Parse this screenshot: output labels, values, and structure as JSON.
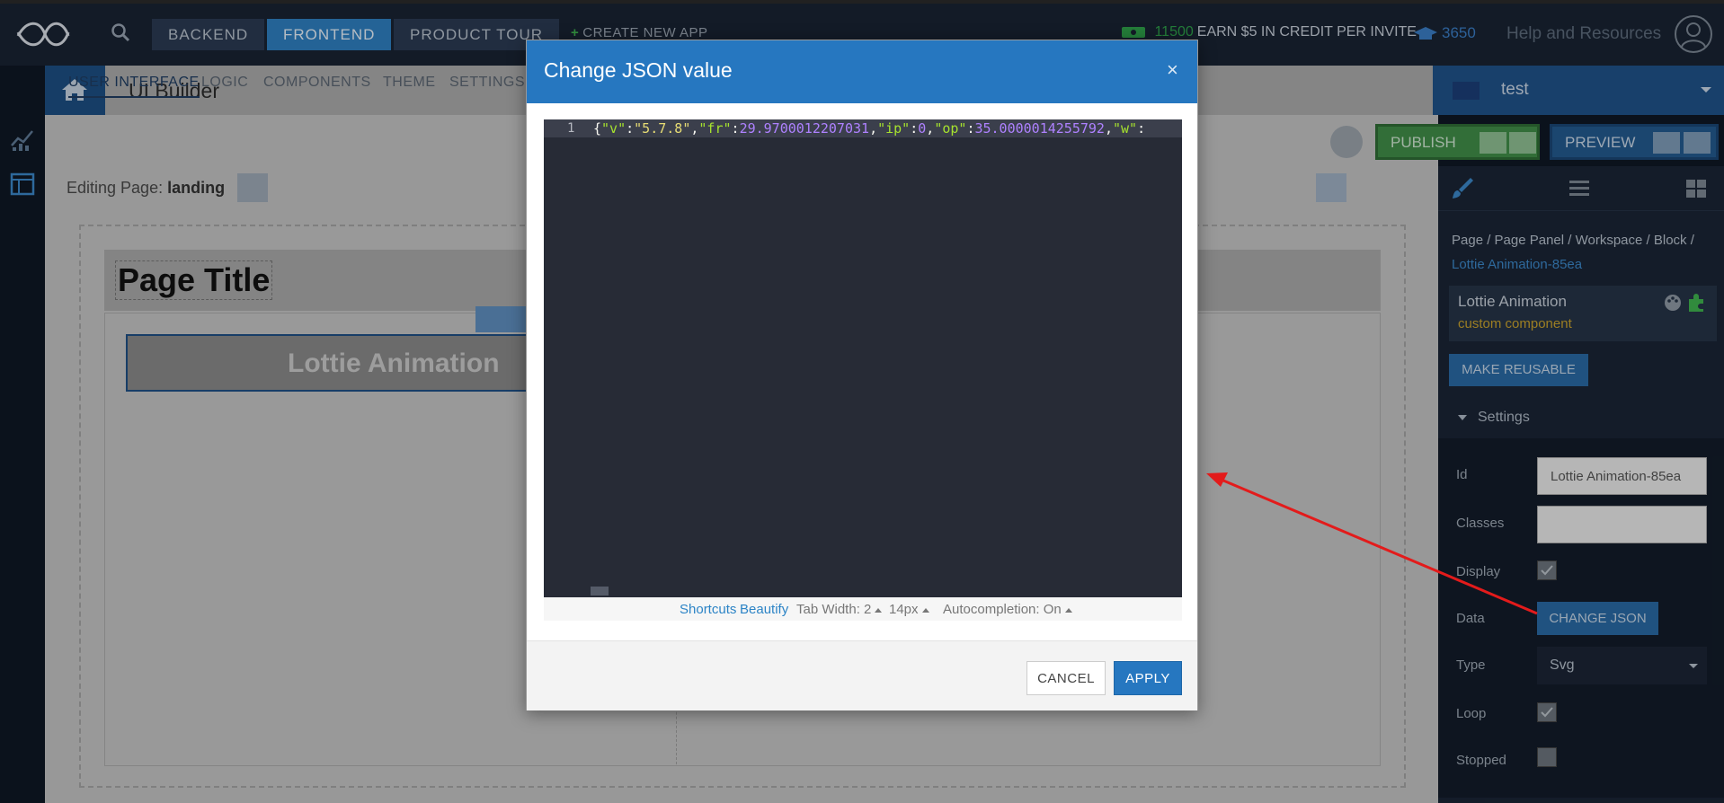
{
  "topbar": {
    "nav": [
      {
        "label": "BACKEND"
      },
      {
        "label": "FRONTEND"
      },
      {
        "label": "PRODUCT TOUR"
      }
    ],
    "create_app": "CREATE NEW APP",
    "credit_count": "11500",
    "credit_text": "EARN $5 IN CREDIT PER INVITE",
    "edu_count": "3650",
    "help": "Help and Resources"
  },
  "builder": {
    "title": "UI Builder",
    "project": "test",
    "tabs": [
      {
        "label": "USER INTERFACE"
      },
      {
        "label": "LOGIC"
      },
      {
        "label": "COMPONENTS"
      },
      {
        "label": "THEME"
      },
      {
        "label": "SETTINGS"
      }
    ],
    "publish": "PUBLISH",
    "preview": "PREVIEW",
    "editing_prefix": "Editing Page:",
    "editing_page": "landing",
    "page_title": "Page Title",
    "lottie_label": "Lottie Animation"
  },
  "panel": {
    "breadcrumb_path": "Page / Page Panel / Workspace / Block /",
    "breadcrumb_current": "Lottie Animation-85ea",
    "component_name": "Lottie Animation",
    "component_type": "custom component",
    "make_reusable": "MAKE REUSABLE",
    "settings_title": "Settings",
    "props": {
      "id_label": "Id",
      "id_value": "Lottie Animation-85ea",
      "classes_label": "Classes",
      "display_label": "Display",
      "data_label": "Data",
      "change_json": "CHANGE JSON",
      "type_label": "Type",
      "type_value": "Svg",
      "loop_label": "Loop",
      "stopped_label": "Stopped"
    }
  },
  "modal": {
    "title": "Change JSON value",
    "close": "×",
    "line_number": "1",
    "code_tokens": [
      {
        "t": "{",
        "c": "#f8f8f2"
      },
      {
        "t": "\"v\"",
        "c": "#a6e22e"
      },
      {
        "t": ":",
        "c": "#f8f8f2"
      },
      {
        "t": "\"5.7.8\"",
        "c": "#e6db74"
      },
      {
        "t": ",",
        "c": "#f8f8f2"
      },
      {
        "t": "\"fr\"",
        "c": "#a6e22e"
      },
      {
        "t": ":",
        "c": "#f8f8f2"
      },
      {
        "t": "29.9700012207031",
        "c": "#ae81ff"
      },
      {
        "t": ",",
        "c": "#f8f8f2"
      },
      {
        "t": "\"ip\"",
        "c": "#a6e22e"
      },
      {
        "t": ":",
        "c": "#f8f8f2"
      },
      {
        "t": "0",
        "c": "#ae81ff"
      },
      {
        "t": ",",
        "c": "#f8f8f2"
      },
      {
        "t": "\"op\"",
        "c": "#a6e22e"
      },
      {
        "t": ":",
        "c": "#f8f8f2"
      },
      {
        "t": "35.0000014255792",
        "c": "#ae81ff"
      },
      {
        "t": ",",
        "c": "#f8f8f2"
      },
      {
        "t": "\"w\"",
        "c": "#a6e22e"
      },
      {
        "t": ":",
        "c": "#f8f8f2"
      }
    ],
    "status": {
      "shortcuts": "Shortcuts",
      "beautify": "Beautify",
      "tab_width": "Tab Width: 2",
      "font_size": "14px",
      "autocompletion": "Autocompletion: On"
    },
    "cancel": "CANCEL",
    "apply": "APPLY"
  },
  "colors": {
    "accent": "#2677c0",
    "annotation_arrow": "#e31b1b",
    "publish_green": "#418e48"
  }
}
